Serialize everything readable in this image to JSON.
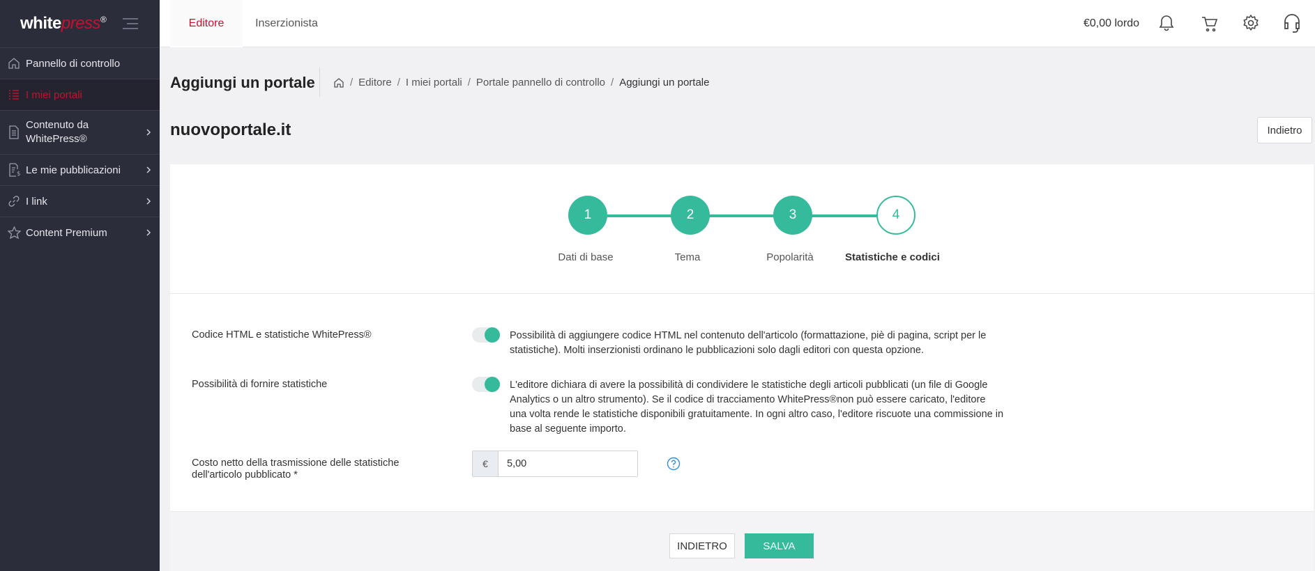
{
  "brand": {
    "logo_white": "white",
    "logo_press": "press",
    "logo_mark": "®"
  },
  "sidebar": {
    "items": [
      {
        "label": "Pannello di controllo",
        "icon": "home-icon"
      },
      {
        "label": "I miei portali",
        "icon": "list-icon",
        "active": true
      },
      {
        "label_line1": "Contenuto da",
        "label_line2": "WhitePress®",
        "icon": "document-icon"
      },
      {
        "label": "Le mie pubblicazioni",
        "icon": "invoice-icon"
      },
      {
        "label": "I link",
        "icon": "link-icon"
      },
      {
        "label": "Content Premium",
        "icon": "star-icon"
      }
    ]
  },
  "topbar": {
    "tabs": [
      "Editore",
      "Inserzionista"
    ],
    "balance": "€0,00 lordo",
    "icons": [
      "bell-icon",
      "cart-icon",
      "gear-icon",
      "headset-icon"
    ]
  },
  "page": {
    "title": "Aggiungi un portale",
    "breadcrumb": [
      "Editore",
      "I miei portali",
      "Portale pannello di controllo",
      "Aggiungi un portale"
    ],
    "portal_name": "nuovoportale.it",
    "back_top_label": "Indietro"
  },
  "steps": [
    {
      "number": "1",
      "label": "Dati di base"
    },
    {
      "number": "2",
      "label": "Tema"
    },
    {
      "number": "3",
      "label": "Popolarità"
    },
    {
      "number": "4",
      "label": "Statistiche e codici",
      "current": true
    }
  ],
  "form": {
    "html_label": "Codice HTML e statistiche WhitePress®",
    "html_desc": "Possibilità di aggiungere codice HTML nel contenuto dell'articolo (formattazione, piè di pagina, script per le statistiche). Molti inserzionisti ordinano le pubblicazioni solo dagli editori con questa opzione.",
    "stats_label": "Possibilità di fornire statistiche",
    "stats_desc": "L'editore dichiara di avere la possibilità di condividere le statistiche degli articoli pubblicati (un file di Google Analytics o un altro strumento). Se il codice di tracciamento WhitePress®non può essere caricato, l'editore una volta rende le statistiche disponibili gratuitamente. In ogni altro caso, l'editore riscuote una commissione in base al seguente importo.",
    "cost_label_line1": "Costo netto della trasmissione delle statistiche",
    "cost_label_line2": "dell'articolo pubblicato *",
    "currency": "€",
    "cost_value": "5,00"
  },
  "actions": {
    "back_label": "INDIETRO",
    "save_label": "SALVA"
  },
  "colors": {
    "accent": "#35bb9b",
    "brand_red": "#c8102e",
    "sidebar_bg": "#2b2d3b"
  }
}
